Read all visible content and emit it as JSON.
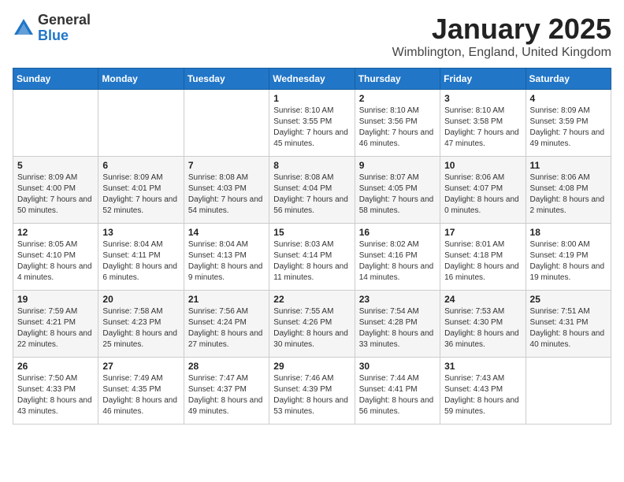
{
  "logo": {
    "general": "General",
    "blue": "Blue"
  },
  "title": {
    "month": "January 2025",
    "location": "Wimblington, England, United Kingdom"
  },
  "weekdays": [
    "Sunday",
    "Monday",
    "Tuesday",
    "Wednesday",
    "Thursday",
    "Friday",
    "Saturday"
  ],
  "weeks": [
    [
      {
        "day": "",
        "sunrise": "",
        "sunset": "",
        "daylight": ""
      },
      {
        "day": "",
        "sunrise": "",
        "sunset": "",
        "daylight": ""
      },
      {
        "day": "",
        "sunrise": "",
        "sunset": "",
        "daylight": ""
      },
      {
        "day": "1",
        "sunrise": "Sunrise: 8:10 AM",
        "sunset": "Sunset: 3:55 PM",
        "daylight": "Daylight: 7 hours and 45 minutes."
      },
      {
        "day": "2",
        "sunrise": "Sunrise: 8:10 AM",
        "sunset": "Sunset: 3:56 PM",
        "daylight": "Daylight: 7 hours and 46 minutes."
      },
      {
        "day": "3",
        "sunrise": "Sunrise: 8:10 AM",
        "sunset": "Sunset: 3:58 PM",
        "daylight": "Daylight: 7 hours and 47 minutes."
      },
      {
        "day": "4",
        "sunrise": "Sunrise: 8:09 AM",
        "sunset": "Sunset: 3:59 PM",
        "daylight": "Daylight: 7 hours and 49 minutes."
      }
    ],
    [
      {
        "day": "5",
        "sunrise": "Sunrise: 8:09 AM",
        "sunset": "Sunset: 4:00 PM",
        "daylight": "Daylight: 7 hours and 50 minutes."
      },
      {
        "day": "6",
        "sunrise": "Sunrise: 8:09 AM",
        "sunset": "Sunset: 4:01 PM",
        "daylight": "Daylight: 7 hours and 52 minutes."
      },
      {
        "day": "7",
        "sunrise": "Sunrise: 8:08 AM",
        "sunset": "Sunset: 4:03 PM",
        "daylight": "Daylight: 7 hours and 54 minutes."
      },
      {
        "day": "8",
        "sunrise": "Sunrise: 8:08 AM",
        "sunset": "Sunset: 4:04 PM",
        "daylight": "Daylight: 7 hours and 56 minutes."
      },
      {
        "day": "9",
        "sunrise": "Sunrise: 8:07 AM",
        "sunset": "Sunset: 4:05 PM",
        "daylight": "Daylight: 7 hours and 58 minutes."
      },
      {
        "day": "10",
        "sunrise": "Sunrise: 8:06 AM",
        "sunset": "Sunset: 4:07 PM",
        "daylight": "Daylight: 8 hours and 0 minutes."
      },
      {
        "day": "11",
        "sunrise": "Sunrise: 8:06 AM",
        "sunset": "Sunset: 4:08 PM",
        "daylight": "Daylight: 8 hours and 2 minutes."
      }
    ],
    [
      {
        "day": "12",
        "sunrise": "Sunrise: 8:05 AM",
        "sunset": "Sunset: 4:10 PM",
        "daylight": "Daylight: 8 hours and 4 minutes."
      },
      {
        "day": "13",
        "sunrise": "Sunrise: 8:04 AM",
        "sunset": "Sunset: 4:11 PM",
        "daylight": "Daylight: 8 hours and 6 minutes."
      },
      {
        "day": "14",
        "sunrise": "Sunrise: 8:04 AM",
        "sunset": "Sunset: 4:13 PM",
        "daylight": "Daylight: 8 hours and 9 minutes."
      },
      {
        "day": "15",
        "sunrise": "Sunrise: 8:03 AM",
        "sunset": "Sunset: 4:14 PM",
        "daylight": "Daylight: 8 hours and 11 minutes."
      },
      {
        "day": "16",
        "sunrise": "Sunrise: 8:02 AM",
        "sunset": "Sunset: 4:16 PM",
        "daylight": "Daylight: 8 hours and 14 minutes."
      },
      {
        "day": "17",
        "sunrise": "Sunrise: 8:01 AM",
        "sunset": "Sunset: 4:18 PM",
        "daylight": "Daylight: 8 hours and 16 minutes."
      },
      {
        "day": "18",
        "sunrise": "Sunrise: 8:00 AM",
        "sunset": "Sunset: 4:19 PM",
        "daylight": "Daylight: 8 hours and 19 minutes."
      }
    ],
    [
      {
        "day": "19",
        "sunrise": "Sunrise: 7:59 AM",
        "sunset": "Sunset: 4:21 PM",
        "daylight": "Daylight: 8 hours and 22 minutes."
      },
      {
        "day": "20",
        "sunrise": "Sunrise: 7:58 AM",
        "sunset": "Sunset: 4:23 PM",
        "daylight": "Daylight: 8 hours and 25 minutes."
      },
      {
        "day": "21",
        "sunrise": "Sunrise: 7:56 AM",
        "sunset": "Sunset: 4:24 PM",
        "daylight": "Daylight: 8 hours and 27 minutes."
      },
      {
        "day": "22",
        "sunrise": "Sunrise: 7:55 AM",
        "sunset": "Sunset: 4:26 PM",
        "daylight": "Daylight: 8 hours and 30 minutes."
      },
      {
        "day": "23",
        "sunrise": "Sunrise: 7:54 AM",
        "sunset": "Sunset: 4:28 PM",
        "daylight": "Daylight: 8 hours and 33 minutes."
      },
      {
        "day": "24",
        "sunrise": "Sunrise: 7:53 AM",
        "sunset": "Sunset: 4:30 PM",
        "daylight": "Daylight: 8 hours and 36 minutes."
      },
      {
        "day": "25",
        "sunrise": "Sunrise: 7:51 AM",
        "sunset": "Sunset: 4:31 PM",
        "daylight": "Daylight: 8 hours and 40 minutes."
      }
    ],
    [
      {
        "day": "26",
        "sunrise": "Sunrise: 7:50 AM",
        "sunset": "Sunset: 4:33 PM",
        "daylight": "Daylight: 8 hours and 43 minutes."
      },
      {
        "day": "27",
        "sunrise": "Sunrise: 7:49 AM",
        "sunset": "Sunset: 4:35 PM",
        "daylight": "Daylight: 8 hours and 46 minutes."
      },
      {
        "day": "28",
        "sunrise": "Sunrise: 7:47 AM",
        "sunset": "Sunset: 4:37 PM",
        "daylight": "Daylight: 8 hours and 49 minutes."
      },
      {
        "day": "29",
        "sunrise": "Sunrise: 7:46 AM",
        "sunset": "Sunset: 4:39 PM",
        "daylight": "Daylight: 8 hours and 53 minutes."
      },
      {
        "day": "30",
        "sunrise": "Sunrise: 7:44 AM",
        "sunset": "Sunset: 4:41 PM",
        "daylight": "Daylight: 8 hours and 56 minutes."
      },
      {
        "day": "31",
        "sunrise": "Sunrise: 7:43 AM",
        "sunset": "Sunset: 4:43 PM",
        "daylight": "Daylight: 8 hours and 59 minutes."
      },
      {
        "day": "",
        "sunrise": "",
        "sunset": "",
        "daylight": ""
      }
    ]
  ]
}
